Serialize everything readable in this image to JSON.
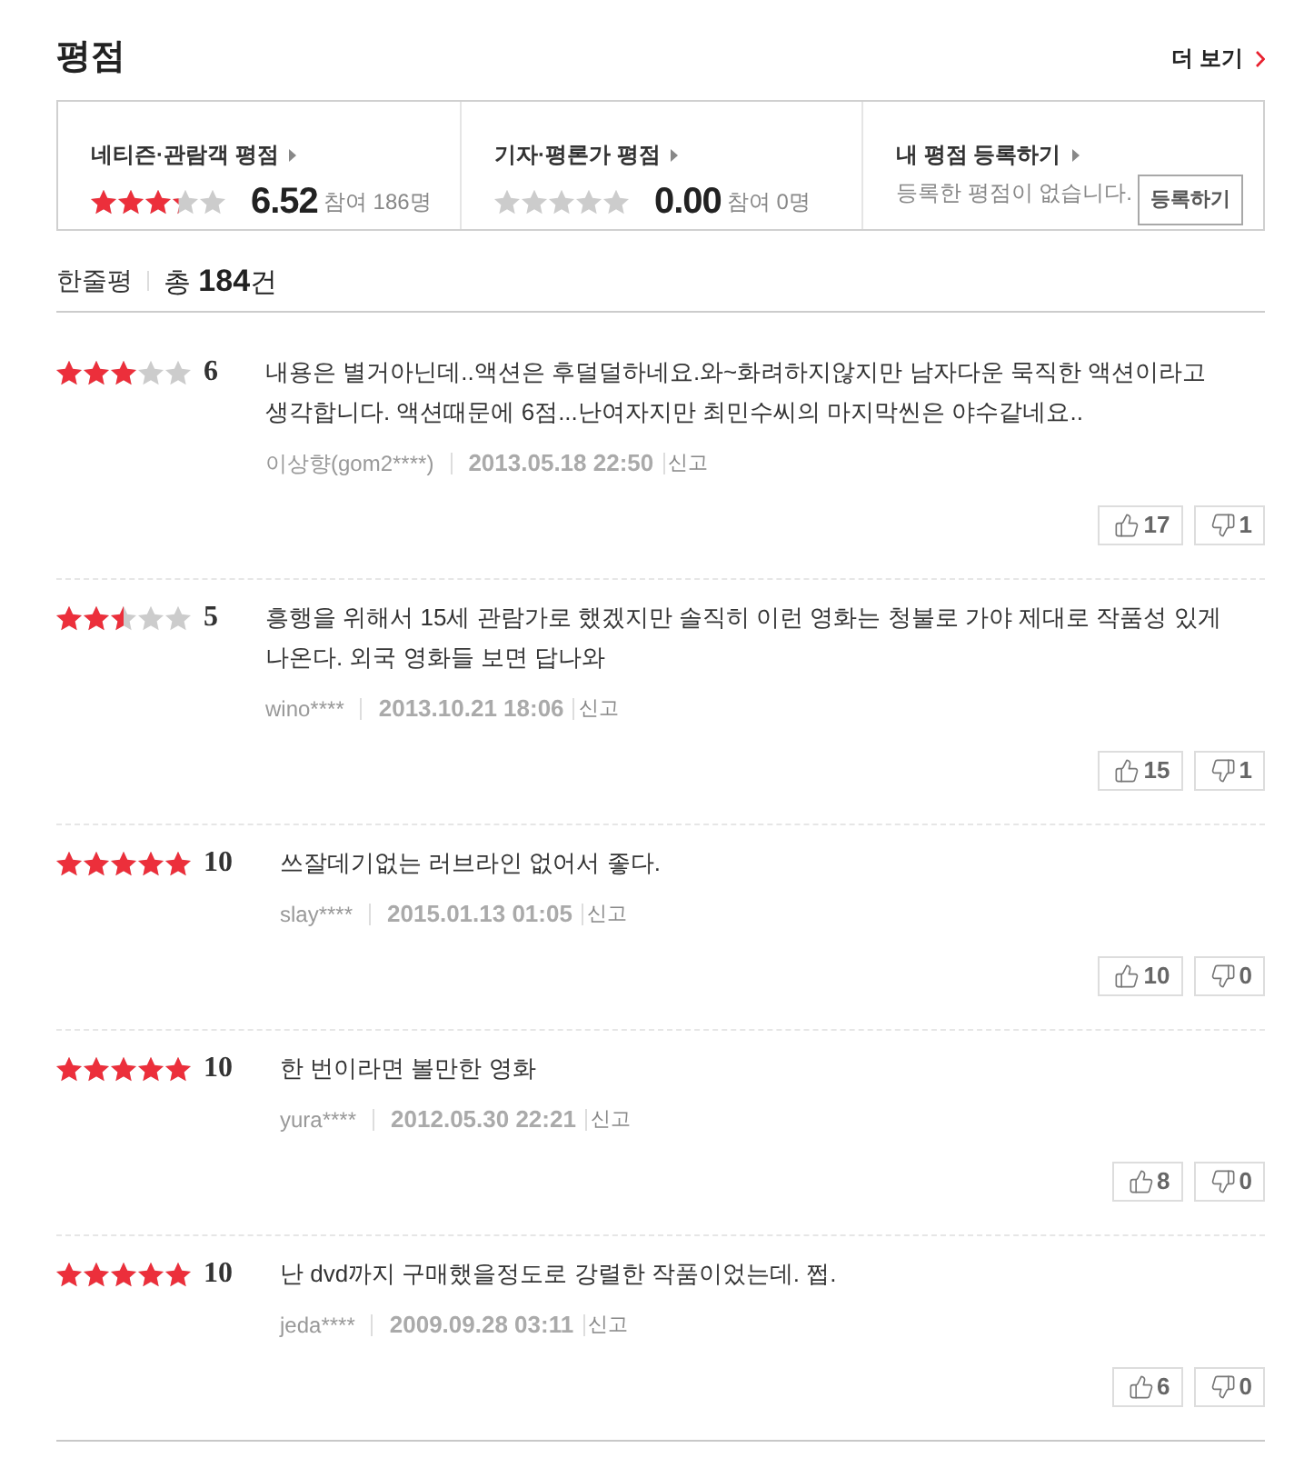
{
  "header": {
    "title": "평점",
    "more_link": "더 보기"
  },
  "rating_summary": [
    {
      "kind": "score",
      "label": "네티즌·관람객 평점",
      "stars": 3.26,
      "score": "6.52",
      "participants": "참여 186명"
    },
    {
      "kind": "score",
      "label": "기자·평론가 평점",
      "stars": 0,
      "score": "0.00",
      "participants": "참여 0명"
    },
    {
      "kind": "register",
      "label": "내 평점 등록하기",
      "message": "등록한 평점이 없습니다.",
      "button": "등록하기"
    }
  ],
  "reviews_header": {
    "title": "한줄평",
    "count": "총 **184**건"
  },
  "reviews": [
    {
      "stars": 3,
      "score": "6",
      "text": "내용은 별거아닌데..액션은 후덜덜하네요.와~화려하지않지만 남자다운 묵직한 액션이라고 생각합니다. 액션때문에 6점...난여자지만 최민수씨의 마지막씬은 야수같네요..",
      "author": "이상향(gom2****)",
      "date": "2013.05.18 22:50",
      "report": "신고",
      "likes": "17",
      "dislikes": "1"
    },
    {
      "stars": 2.5,
      "score": "5",
      "text": "흥행을 위해서 15세 관람가로 했겠지만 솔직히 이런 영화는 청불로 가야 제대로 작품성 있게 나온다. 외국 영화들 보면 답나와",
      "author": "wino****",
      "date": "2013.10.21 18:06",
      "report": "신고",
      "likes": "15",
      "dislikes": "1"
    },
    {
      "stars": 5,
      "score": "10",
      "text": "쓰잘데기없는 러브라인 없어서 좋다.",
      "author": "slay****",
      "date": "2015.01.13 01:05",
      "report": "신고",
      "likes": "10",
      "dislikes": "0"
    },
    {
      "stars": 5,
      "score": "10",
      "text": "한 번이라면 볼만한 영화",
      "author": "yura****",
      "date": "2012.05.30 22:21",
      "report": "신고",
      "likes": "8",
      "dislikes": "0"
    },
    {
      "stars": 5,
      "score": "10",
      "text": "난 dvd까지 구매했을정도로 강렬한 작품이었는데. 쩝.",
      "author": "jeda****",
      "date": "2009.09.28 03:11",
      "report": "신고",
      "likes": "6",
      "dislikes": "0"
    }
  ]
}
